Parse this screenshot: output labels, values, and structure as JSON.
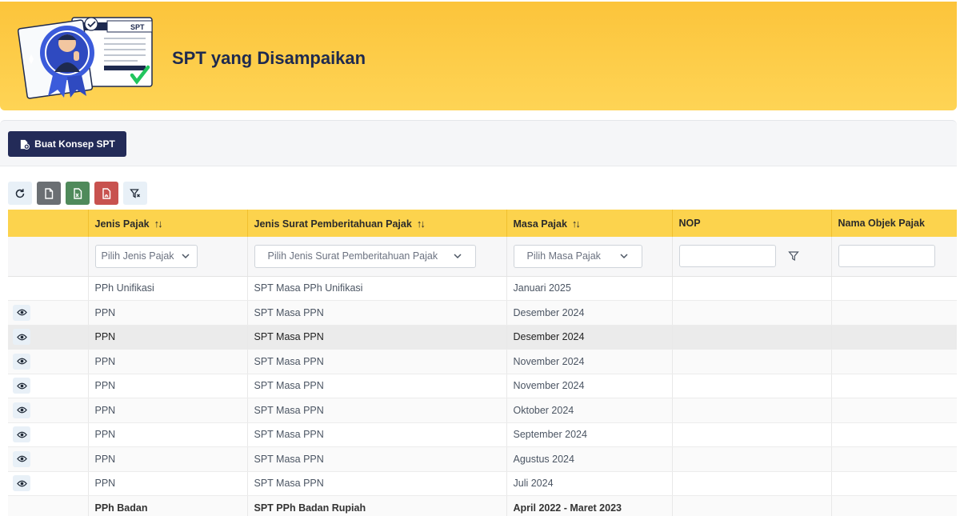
{
  "page": {
    "title": "SPT yang Disampaikan",
    "illustration_label": "SPT"
  },
  "toolbar": {
    "create_label": "Buat Konsep SPT"
  },
  "icon_buttons": [
    "refresh-icon",
    "csv-export-icon",
    "excel-export-icon",
    "pdf-export-icon",
    "clear-filter-icon"
  ],
  "table": {
    "columns": [
      "",
      "Jenis Pajak",
      "Jenis Surat Pemberitahuan Pajak",
      "Masa Pajak",
      "NOP",
      "Nama Objek Pajak"
    ],
    "filters": {
      "jenis_pajak": "Pilih Jenis Pajak",
      "jenis_spt": "Pilih Jenis Surat Pemberitahuan Pajak",
      "masa_pajak": "Pilih Masa Pajak",
      "nop": "",
      "nama_objek": ""
    },
    "rows": [
      {
        "jenis": "PPh Unifikasi",
        "spt": "SPT Masa PPh Unifikasi",
        "masa": "Januari 2025",
        "nop": "",
        "nama": "",
        "view": false
      },
      {
        "jenis": "PPN",
        "spt": "SPT Masa PPN",
        "masa": "Desember 2024",
        "nop": "",
        "nama": "",
        "view": true
      },
      {
        "jenis": "PPN",
        "spt": "SPT Masa PPN",
        "masa": "Desember 2024",
        "nop": "",
        "nama": "",
        "view": true
      },
      {
        "jenis": "PPN",
        "spt": "SPT Masa PPN",
        "masa": "November 2024",
        "nop": "",
        "nama": "",
        "view": true
      },
      {
        "jenis": "PPN",
        "spt": "SPT Masa PPN",
        "masa": "November 2024",
        "nop": "",
        "nama": "",
        "view": true
      },
      {
        "jenis": "PPN",
        "spt": "SPT Masa PPN",
        "masa": "Oktober 2024",
        "nop": "",
        "nama": "",
        "view": true
      },
      {
        "jenis": "PPN",
        "spt": "SPT Masa PPN",
        "masa": "September 2024",
        "nop": "",
        "nama": "",
        "view": true
      },
      {
        "jenis": "PPN",
        "spt": "SPT Masa PPN",
        "masa": "Agustus 2024",
        "nop": "",
        "nama": "",
        "view": true
      },
      {
        "jenis": "PPN",
        "spt": "SPT Masa PPN",
        "masa": "Juli 2024",
        "nop": "",
        "nama": "",
        "view": true
      },
      {
        "jenis": "PPh Badan",
        "spt": "SPT PPh Badan Rupiah",
        "masa": "April 2022 - Maret 2023",
        "nop": "",
        "nama": "",
        "view": false
      }
    ]
  },
  "colors": {
    "banner": "#fcc43b",
    "header_row": "#fcd34d",
    "primary_button": "#232b58",
    "title_text": "#1e2a4f"
  }
}
